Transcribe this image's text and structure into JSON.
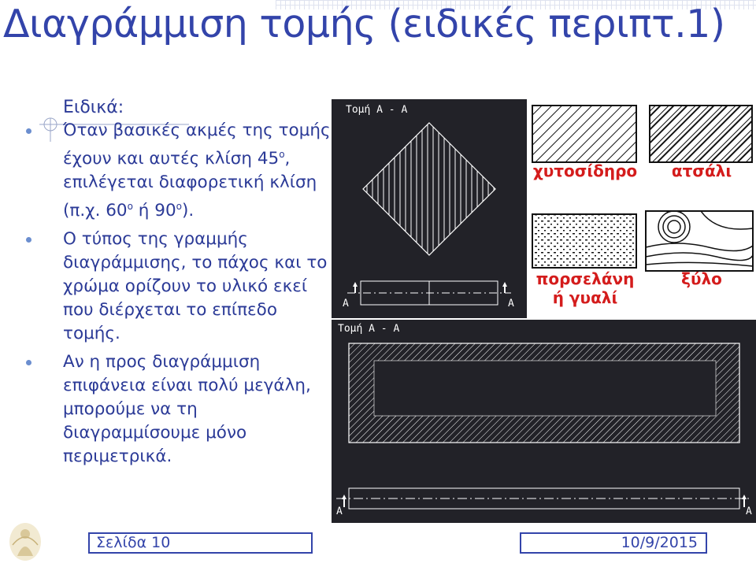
{
  "slide": {
    "title": "Διαγράμμιση τομής (ειδικές περιπτ.1)",
    "intro": "Ειδικά:",
    "bullets": [
      {
        "pre": "Όταν βασικές ακμές της τομής έχουν και αυτές κλίση 45",
        "sup1": "ο",
        "mid": ", επιλέγεται διαφορετική κλίση (π.χ. 60",
        "sup2": "ο",
        "mid2": " ή 90",
        "sup3": "ο",
        "post": ")."
      },
      {
        "text": "Ο τύπος της γραμμής διαγράμμισης, το πάχος και το χρώμα ορίζουν το υλικό εκεί που διέρχεται το επίπεδο τομής."
      },
      {
        "text": "Αν η προς διαγράμμιση επιφάνεια είναι πολύ μεγάλη, μπορούμε να τη διαγραμμίσουμε μόνο περιμετρικά."
      }
    ]
  },
  "drawings": {
    "section_label": "Τομή  Α - Α",
    "cut_letter": "Α"
  },
  "materials": {
    "cast_iron": "χυτοσίδηρο",
    "steel": "ατσάλι",
    "porcelain_line1": "πορσελάνη",
    "porcelain_line2": "ή γυαλί",
    "wood": "ξύλο"
  },
  "footer": {
    "page": "Σελίδα 10",
    "date": "10/9/2015"
  }
}
